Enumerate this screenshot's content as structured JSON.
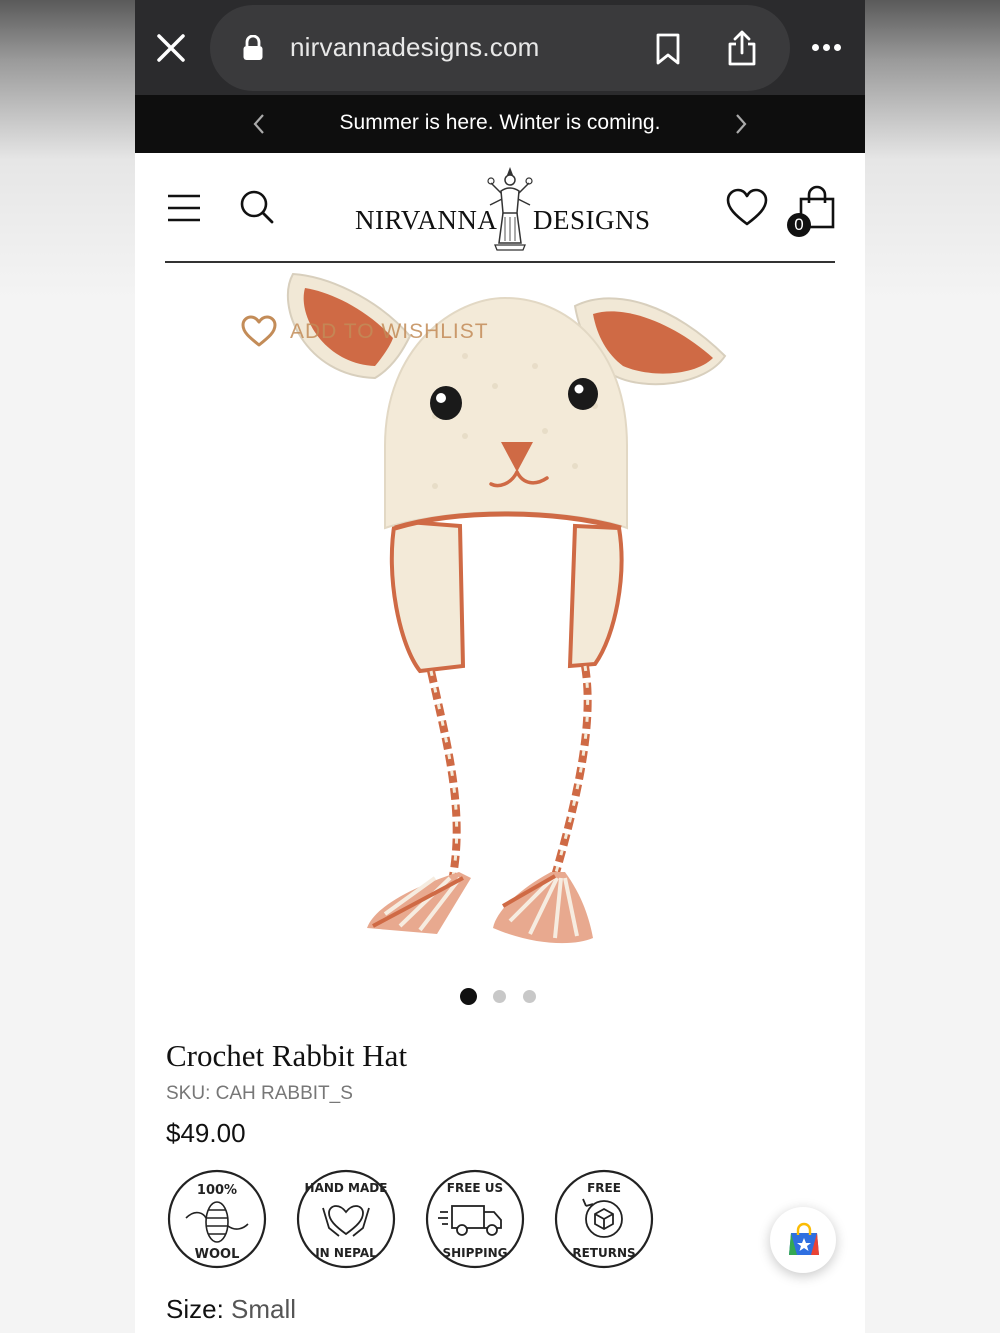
{
  "browser": {
    "url": "nirvannadesigns.com",
    "close_icon": "close-icon",
    "lock_icon": "lock-icon",
    "bookmark_icon": "bookmark-icon",
    "share_icon": "share-icon",
    "more_icon": "more-icon"
  },
  "announcement": {
    "text": "Summer is here. Winter is coming.",
    "prev_icon": "chevron-left-icon",
    "next_icon": "chevron-right-icon"
  },
  "header": {
    "logo_left": "NIRVANNA",
    "logo_right": "DESIGNS",
    "cart_count": "0",
    "menu_icon": "menu-icon",
    "search_icon": "search-icon",
    "wishlist_icon": "heart-icon",
    "cart_icon": "shopping-bag-icon"
  },
  "product": {
    "wishlist_label": "ADD TO WISHLIST",
    "title": "Crochet Rabbit Hat",
    "sku": "SKU: CAH RABBIT_S",
    "price": "$49.00",
    "image_count": 3,
    "active_image": 1,
    "badges": [
      {
        "top": "100%",
        "bottom": "WOOL",
        "icon": "yarn-icon"
      },
      {
        "top": "HAND MADE",
        "bottom": "IN NEPAL",
        "icon": "hands-heart-icon"
      },
      {
        "top": "FREE US",
        "bottom": "SHIPPING",
        "icon": "truck-icon"
      },
      {
        "top": "FREE",
        "bottom": "RETURNS",
        "icon": "box-return-icon"
      }
    ],
    "size_label": "Size:",
    "size_value": "Small"
  },
  "colors": {
    "accent": "#c38c58",
    "hat_orange": "#d0704e",
    "hat_cream": "#f3ead8",
    "topbar": "#2b2b2d",
    "announcement_bg": "#0e0e0e"
  }
}
